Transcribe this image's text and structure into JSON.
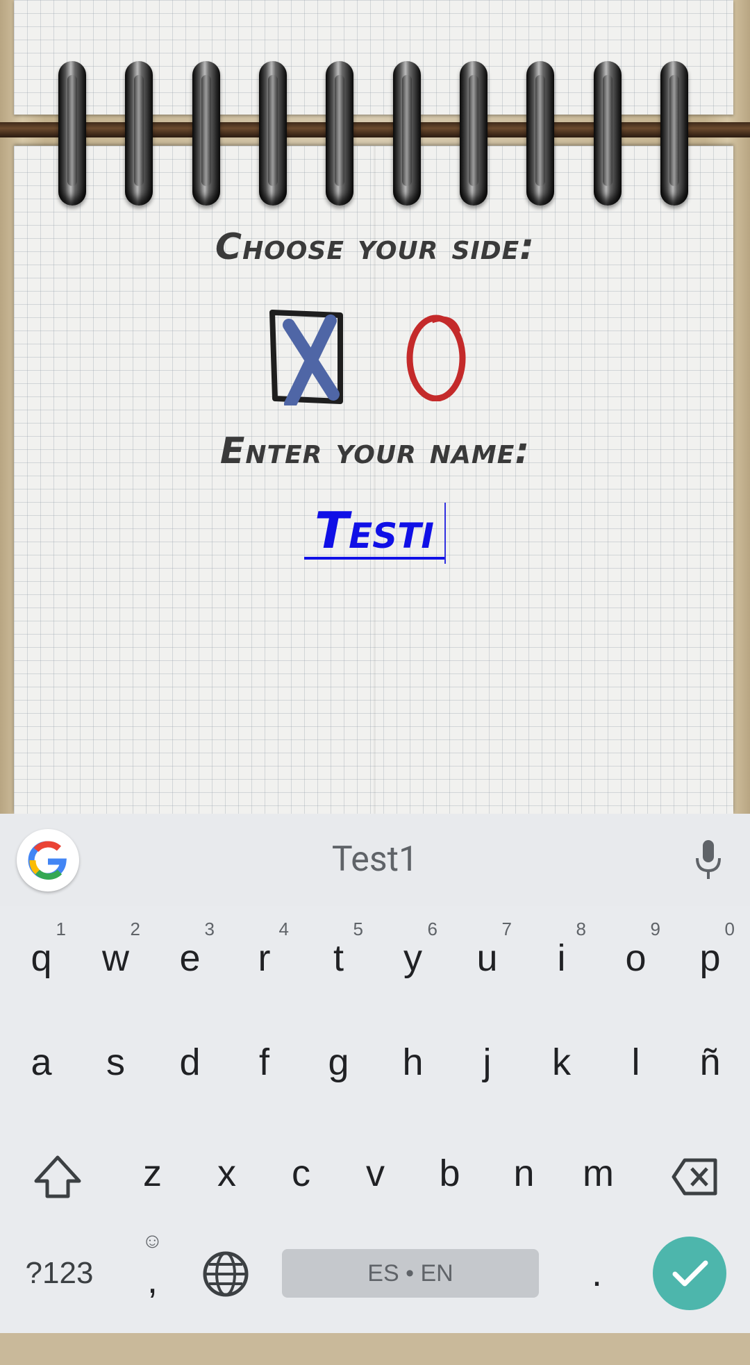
{
  "game": {
    "choose_label": "Choose your side:",
    "side_x": "X",
    "side_o": "O",
    "name_label": "Enter your name:",
    "name_value": "Testi"
  },
  "keyboard": {
    "suggestion": "Test1",
    "row1": [
      {
        "k": "q",
        "n": "1"
      },
      {
        "k": "w",
        "n": "2"
      },
      {
        "k": "e",
        "n": "3"
      },
      {
        "k": "r",
        "n": "4"
      },
      {
        "k": "t",
        "n": "5"
      },
      {
        "k": "y",
        "n": "6"
      },
      {
        "k": "u",
        "n": "7"
      },
      {
        "k": "i",
        "n": "8"
      },
      {
        "k": "o",
        "n": "9"
      },
      {
        "k": "p",
        "n": "0"
      }
    ],
    "row2": [
      "a",
      "s",
      "d",
      "f",
      "g",
      "h",
      "j",
      "k",
      "l",
      "ñ"
    ],
    "row3": [
      "z",
      "x",
      "c",
      "v",
      "b",
      "n",
      "m"
    ],
    "symbols_key": "?123",
    "comma_key": ",",
    "period_key": ".",
    "space_label": "ES • EN"
  }
}
